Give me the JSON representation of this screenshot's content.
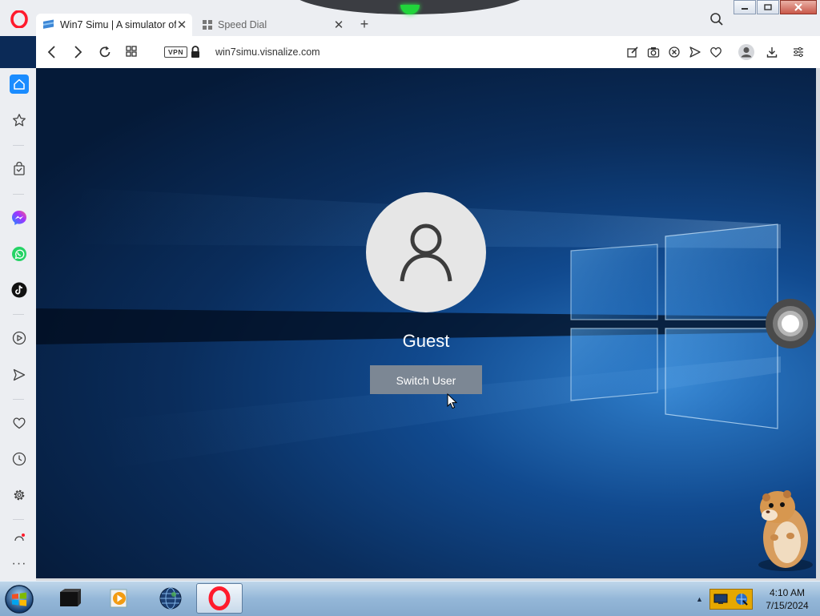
{
  "browser": {
    "tabs": [
      {
        "title": "Win7 Simu | A simulator of",
        "active": true
      },
      {
        "title": "Speed Dial",
        "active": false
      }
    ],
    "new_tab_label": "+",
    "vpn_label": "VPN",
    "url": "win7simu.visnalize.com"
  },
  "sidebar": {
    "icons": [
      "home-icon",
      "bookmarks-icon",
      "shopping-icon",
      "messenger-icon",
      "whatsapp-icon",
      "tiktok-icon",
      "player-icon",
      "send-icon",
      "heart-icon",
      "history-icon",
      "settings-icon",
      "more-icon"
    ],
    "more_label": "···"
  },
  "lockscreen": {
    "user_name": "Guest",
    "switch_user_label": "Switch User"
  },
  "taskbar": {
    "apps": [
      "terminal-icon",
      "media-player-icon",
      "globe-icon",
      "opera-icon"
    ],
    "show_hidden_label": "▲",
    "clock_time": "4:10 AM",
    "clock_date": "7/15/2024"
  },
  "colors": {
    "accent": "#1a8cff",
    "opera_red": "#ff1b2d",
    "messenger": "#a033ff",
    "whatsapp": "#25d366",
    "vpn_notch": "#21d43b"
  }
}
